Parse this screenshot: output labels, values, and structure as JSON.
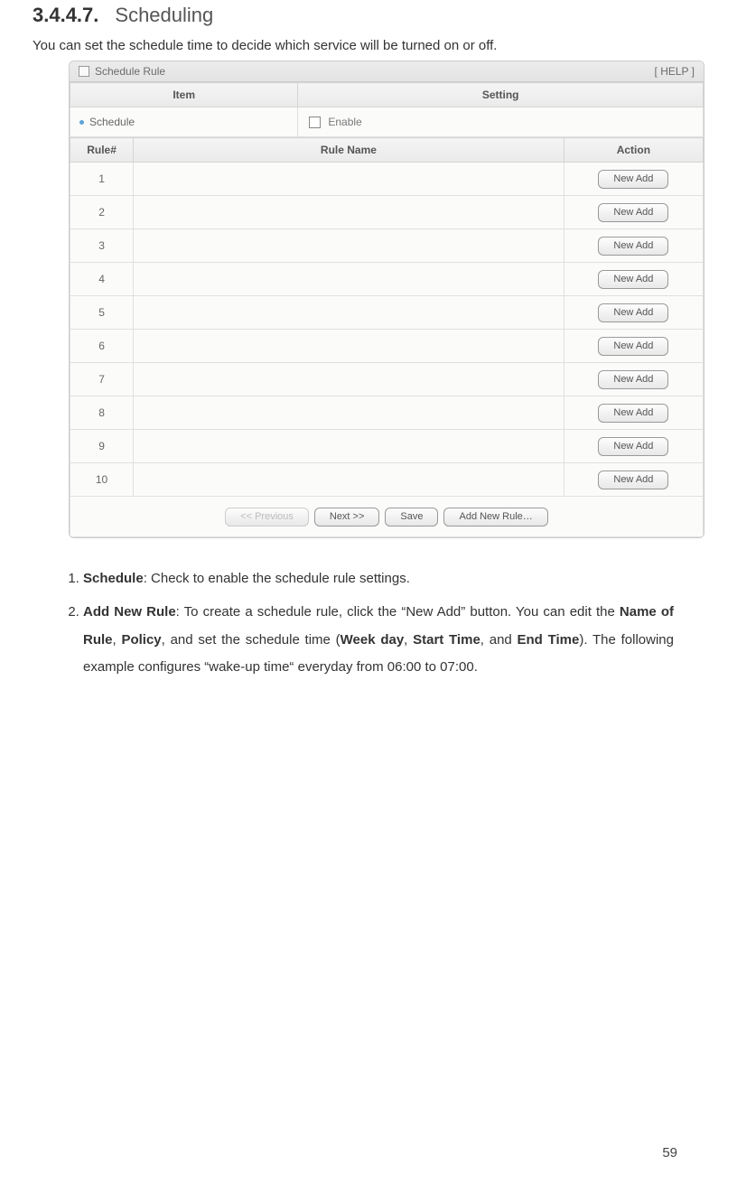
{
  "heading": {
    "number": "3.4.4.7.",
    "title": "Scheduling"
  },
  "intro": "You can set the schedule time to decide which service will be turned on or off.",
  "panel": {
    "title": "Schedule Rule",
    "help": "[ HELP ]",
    "cols": {
      "item": "Item",
      "setting": "Setting"
    },
    "schedule_label": "Schedule",
    "enable_label": "Enable",
    "rule_cols": {
      "num": "Rule#",
      "name": "Rule Name",
      "action": "Action"
    },
    "rows": [
      {
        "n": "1",
        "name": "",
        "btn": "New Add"
      },
      {
        "n": "2",
        "name": "",
        "btn": "New Add"
      },
      {
        "n": "3",
        "name": "",
        "btn": "New Add"
      },
      {
        "n": "4",
        "name": "",
        "btn": "New Add"
      },
      {
        "n": "5",
        "name": "",
        "btn": "New Add"
      },
      {
        "n": "6",
        "name": "",
        "btn": "New Add"
      },
      {
        "n": "7",
        "name": "",
        "btn": "New Add"
      },
      {
        "n": "8",
        "name": "",
        "btn": "New Add"
      },
      {
        "n": "9",
        "name": "",
        "btn": "New Add"
      },
      {
        "n": "10",
        "name": "",
        "btn": "New Add"
      }
    ],
    "footer": {
      "prev": "<< Previous",
      "next": "Next >>",
      "save": "Save",
      "add": "Add New Rule…"
    }
  },
  "desc": {
    "item1": {
      "b": "Schedule",
      "rest": ": Check to enable the schedule rule settings."
    },
    "item2": {
      "b1": "Add New Rule",
      "t1": ": To create a schedule rule, click the “New Add” button. You can edit the ",
      "b2": "Name of Rule",
      "t2": ", ",
      "b3": "Policy",
      "t3": ", and set the schedule time (",
      "b4": "Week day",
      "t4": ", ",
      "b5": "Start Time",
      "t5": ", and ",
      "b6": "End Time",
      "t6": "). The following example configures “wake-up time“ everyday from 06:00 to 07:00."
    }
  },
  "page_number": "59"
}
